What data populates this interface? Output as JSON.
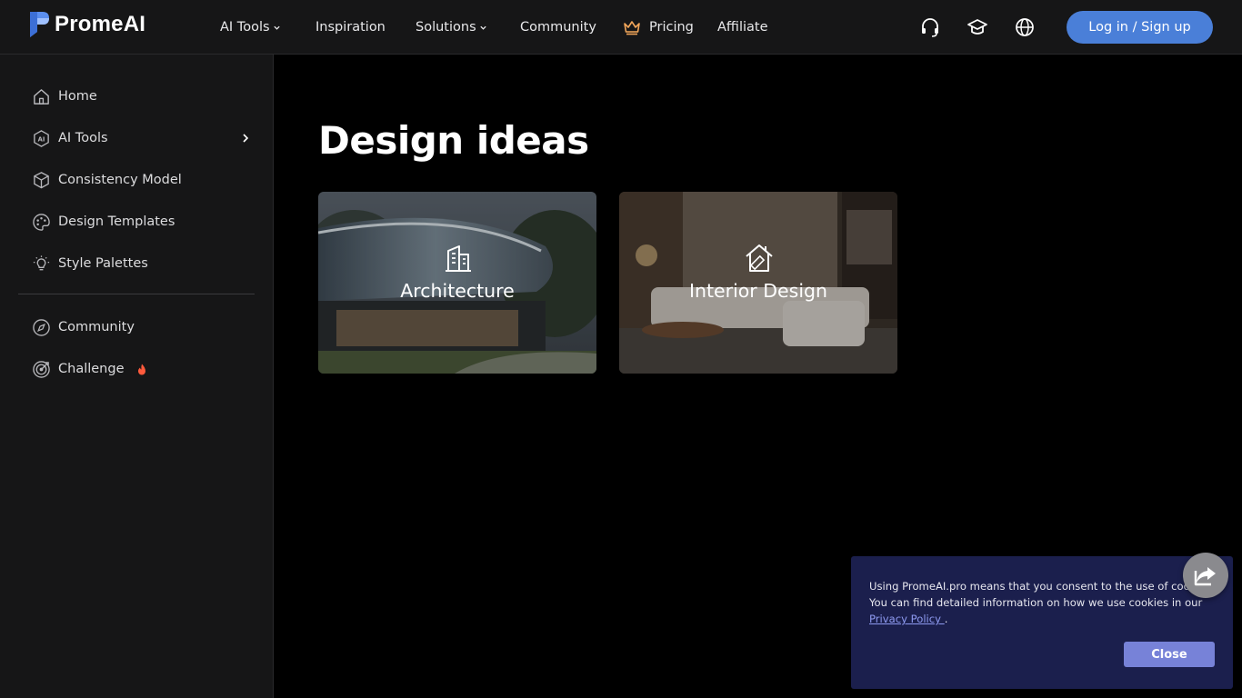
{
  "brand": {
    "name": "PromeAI"
  },
  "nav": {
    "items": [
      {
        "label": "AI Tools",
        "has_dropdown": true
      },
      {
        "label": "Inspiration",
        "has_dropdown": false
      },
      {
        "label": "Solutions",
        "has_dropdown": true
      },
      {
        "label": "Community",
        "has_dropdown": false
      },
      {
        "label": "Pricing",
        "icon": "crown-icon"
      },
      {
        "label": "Affiliate",
        "has_dropdown": false
      }
    ],
    "utility_icons": [
      "headset-icon",
      "graduation-cap-icon",
      "globe-icon"
    ],
    "login_label": "Log in / Sign up"
  },
  "sidebar": {
    "items": [
      {
        "label": "Home",
        "icon": "home-icon"
      },
      {
        "label": "AI Tools",
        "icon": "ai-icon"
      },
      {
        "label": "Consistency Model",
        "icon": "cube-icon"
      },
      {
        "label": "Design Templates",
        "icon": "palette-icon"
      },
      {
        "label": "Style Palettes",
        "icon": "lightbulb-icon"
      },
      {
        "label": "Community",
        "icon": "compass-icon"
      },
      {
        "label": "Challenge",
        "icon": "target-icon"
      }
    ]
  },
  "main": {
    "title": "Design ideas",
    "cards": [
      {
        "label": "Architecture",
        "icon": "building-icon"
      },
      {
        "label": "Interior Design",
        "icon": "house-ruler-icon"
      }
    ]
  },
  "cookie": {
    "line1": "Using PromeAI.pro means that you consent to the use of cookies.",
    "line2": "You can find detailed information on how we use cookies in our",
    "link": "Privacy Policy ",
    "after_link": ".",
    "close_label": "Close"
  },
  "colors": {
    "accent": "#4a7fd8",
    "banner": "#1b1f4d",
    "close_button": "#7782d8",
    "challenge_flame": "#ff5a3c",
    "pricing_crown": "#f2a65a"
  }
}
